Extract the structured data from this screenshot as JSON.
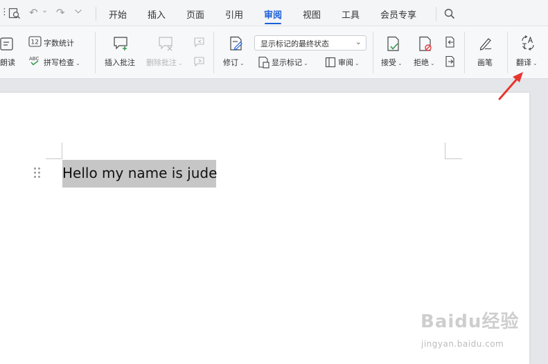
{
  "quick_access": {
    "undo_arrow": "↶",
    "redo_arrow": "↷",
    "more_chevron": "⌵",
    "dropdown_caret": "⌄"
  },
  "menu": {
    "tabs": [
      "开始",
      "插入",
      "页面",
      "引用",
      "审阅",
      "视图",
      "工具",
      "会员专享"
    ],
    "active_tab": "审阅"
  },
  "ribbon": {
    "read_aloud": "朗读",
    "word_count": "字数统计",
    "spell_check": "拼写检查",
    "insert_comment": "插入批注",
    "delete_comment": "删除批注",
    "track_changes": "修订",
    "markup_state": "显示标记的最终状态",
    "show_markup": "显示标记",
    "review_pane": "审阅",
    "accept": "接受",
    "reject": "拒绝",
    "pen": "画笔",
    "translate": "翻译",
    "caret": "⌄",
    "word_count_badge": "12",
    "abc_badge": "ABC"
  },
  "document": {
    "text": "Hello my name is jude"
  },
  "watermark": {
    "brand": "Baidu经验",
    "url": "jingyan.baidu.com"
  },
  "colors": {
    "accent": "#1b5fd9",
    "annotation_arrow": "#e8352e",
    "selection": "#c6c6c6"
  }
}
